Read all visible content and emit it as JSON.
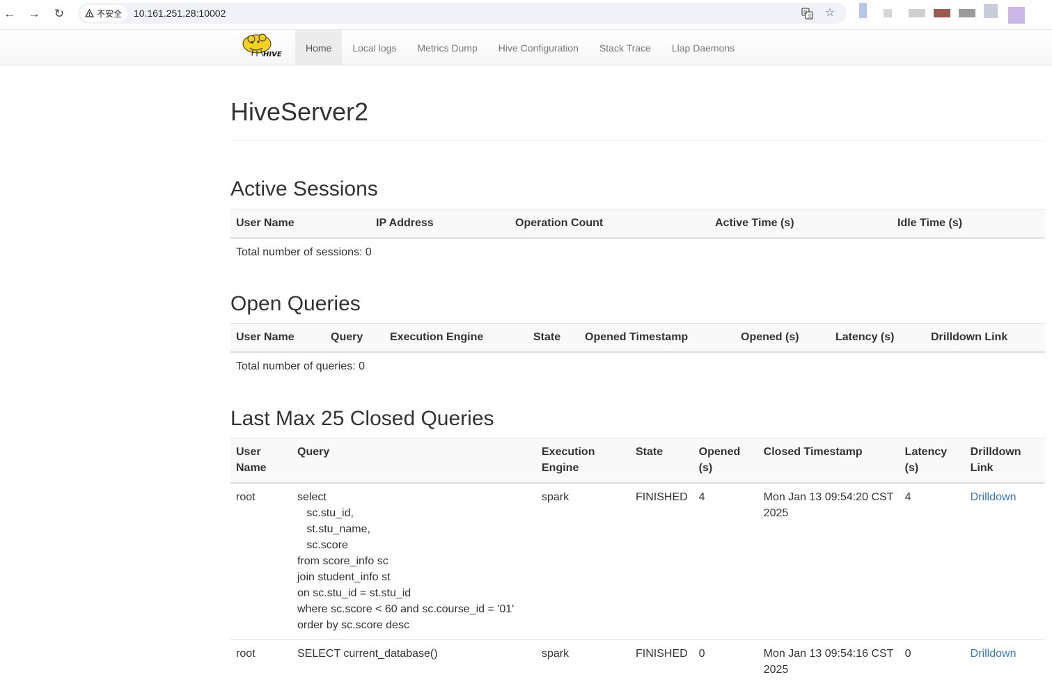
{
  "browser": {
    "security_label": "不安全",
    "url": "10.161.251.28:10002",
    "ext_colors": [
      "#b7c6e8",
      "#d6d6d6",
      "#cfcfcf",
      "#9a5a4e",
      "#9b9b9b",
      "#c8ccd6",
      "#cbb8e6"
    ]
  },
  "navbar": {
    "logo_text": "HIVE",
    "links": [
      "Home",
      "Local logs",
      "Metrics Dump",
      "Hive Configuration",
      "Stack Trace",
      "Llap Daemons"
    ],
    "active_index": 0
  },
  "page": {
    "title": "HiveServer2"
  },
  "active_sessions": {
    "title": "Active Sessions",
    "headers": [
      "User Name",
      "IP Address",
      "Operation Count",
      "Active Time (s)",
      "Idle Time (s)"
    ],
    "summary": "Total number of sessions: 0"
  },
  "open_queries": {
    "title": "Open Queries",
    "headers": [
      "User Name",
      "Query",
      "Execution Engine",
      "State",
      "Opened Timestamp",
      "Opened (s)",
      "Latency (s)",
      "Drilldown Link"
    ],
    "summary": "Total number of queries: 0"
  },
  "closed_queries": {
    "title": "Last Max 25 Closed Queries",
    "headers": [
      "User\nName",
      "Query",
      "Execution\nEngine",
      "State",
      "Opened\n(s)",
      "Closed Timestamp",
      "Latency\n(s)",
      "Drilldown\nLink"
    ],
    "rows": [
      {
        "user": "root",
        "query": "select\n   sc.stu_id,\n   st.stu_name,\n   sc.score\nfrom score_info sc\njoin student_info st\non sc.stu_id = st.stu_id\nwhere sc.score < 60 and sc.course_id = '01'\norder by sc.score desc",
        "engine": "spark",
        "state": "FINISHED",
        "opened": "4",
        "closed": "Mon Jan 13 09:54:20 CST 2025",
        "latency": "4",
        "link": "Drilldown"
      },
      {
        "user": "root",
        "query": "SELECT current_database()",
        "engine": "spark",
        "state": "FINISHED",
        "opened": "0",
        "closed": "Mon Jan 13 09:54:16 CST 2025",
        "latency": "0",
        "link": "Drilldown"
      }
    ]
  }
}
